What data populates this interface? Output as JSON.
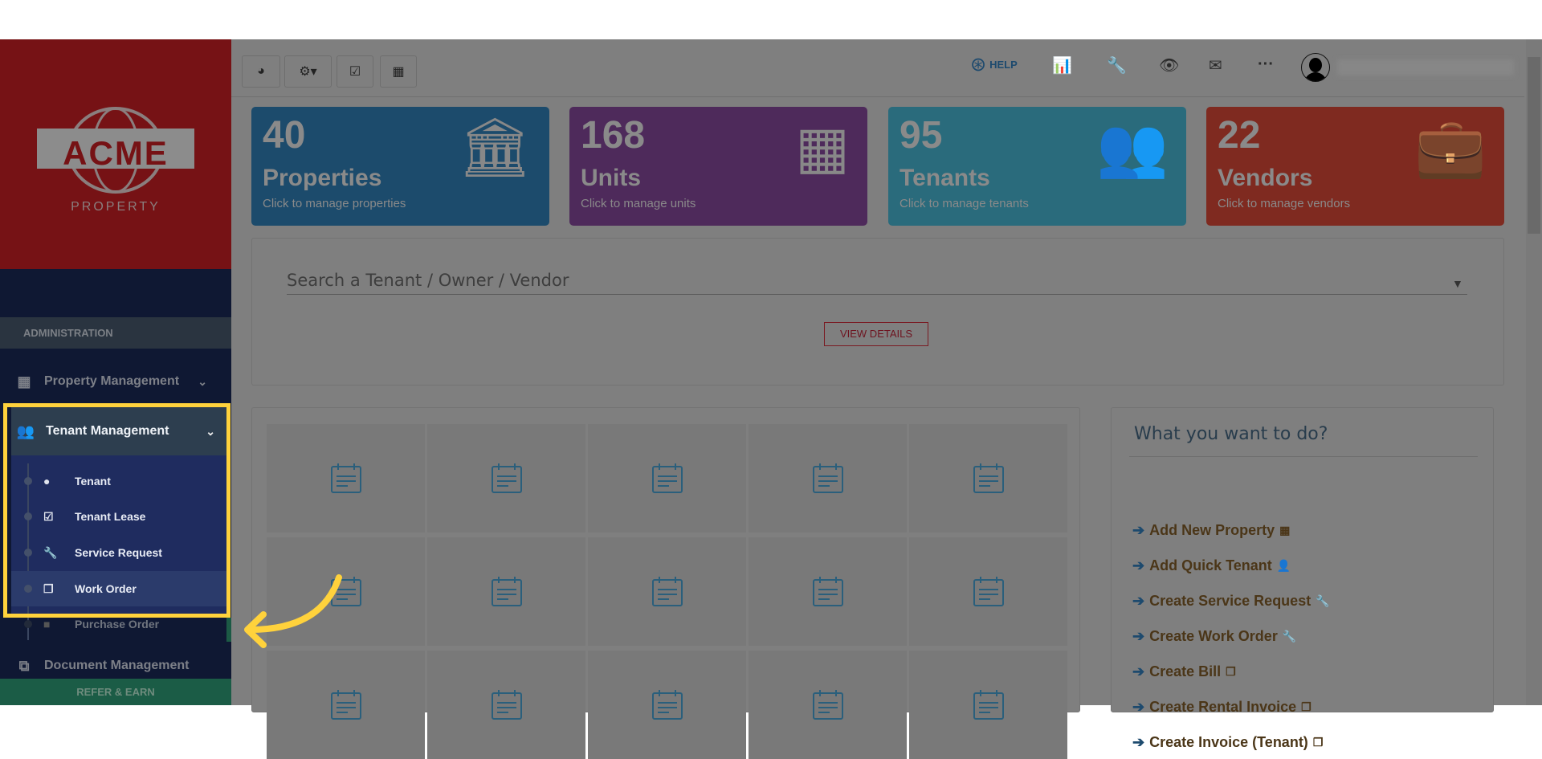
{
  "sidebar": {
    "logo": {
      "brand": "ACME",
      "sub": "PROPERTY"
    },
    "section": "ADMINISTRATION",
    "items": [
      {
        "label": "Property Management",
        "icon": "building-icon"
      },
      {
        "label": "Tenant Management",
        "icon": "users-icon"
      },
      {
        "label": "Document Management",
        "icon": "documents-icon"
      }
    ],
    "subitems": [
      {
        "label": "Tenant",
        "icon": "user-icon"
      },
      {
        "label": "Tenant Lease",
        "icon": "calendar-check-icon"
      },
      {
        "label": "Service Request",
        "icon": "wrench-icon"
      },
      {
        "label": "Work Order",
        "icon": "copy-icon"
      },
      {
        "label": "Purchase Order",
        "icon": "truck-icon"
      }
    ],
    "refer": "REFER & EARN"
  },
  "header": {
    "help": "HELP"
  },
  "cards": [
    {
      "num": "40",
      "label": "Properties",
      "sub": "Click to manage properties",
      "color": "#1c4b6c"
    },
    {
      "num": "168",
      "label": "Units",
      "sub": "Click to manage units",
      "color": "#4e2a5b"
    },
    {
      "num": "95",
      "label": "Tenants",
      "sub": "Click to manage tenants",
      "color": "#2a6b7c"
    },
    {
      "num": "22",
      "label": "Vendors",
      "sub": "Click to manage vendors",
      "color": "#7f2a20"
    }
  ],
  "search": {
    "placeholder": "Search a Tenant / Owner / Vendor",
    "button": "VIEW DETAILS"
  },
  "actions": {
    "title": "What you want to do?",
    "items": [
      "Add New Property",
      "Add Quick Tenant",
      "Create Service Request",
      "Create Work Order",
      "Create Bill",
      "Create Rental Invoice",
      "Create Invoice (Tenant)"
    ]
  }
}
